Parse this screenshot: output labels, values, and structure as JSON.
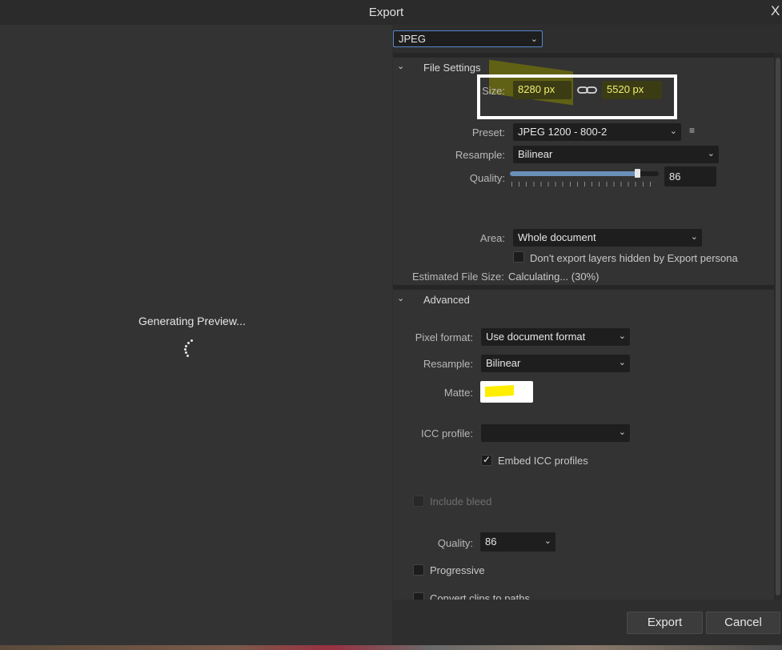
{
  "window": {
    "title": "Export",
    "close_glyph": "X"
  },
  "preview": {
    "generating_text": "Generating Preview..."
  },
  "format": {
    "value": "JPEG"
  },
  "file_settings": {
    "section_title": "File Settings",
    "size_label": "Size:",
    "width": "8280 px",
    "height": "5520 px",
    "preset_label": "Preset:",
    "preset_value": "JPEG 1200 - 800-2",
    "resample_label": "Resample:",
    "resample_value": "Bilinear",
    "quality_label": "Quality:",
    "quality_value": "86",
    "quality_fraction": 0.86,
    "area_label": "Area:",
    "area_value": "Whole document",
    "dont_export_hidden_label": "Don't export layers hidden by Export persona",
    "estimated_size_label": "Estimated File Size:",
    "estimated_size_value": "Calculating... (30%)"
  },
  "advanced": {
    "section_title": "Advanced",
    "pixel_format_label": "Pixel format:",
    "pixel_format_value": "Use document format",
    "resample_label": "Resample:",
    "resample_value": "Bilinear",
    "matte_label": "Matte:",
    "icc_label": "ICC profile:",
    "icc_value": "",
    "embed_icc_label": "Embed ICC profiles",
    "include_bleed_label": "Include bleed",
    "quality_label": "Quality:",
    "quality_value": "86",
    "progressive_label": "Progressive",
    "convert_clips_label": "Convert clips to paths"
  },
  "buttons": {
    "export": "Export",
    "cancel": "Cancel"
  },
  "colors": {
    "highlight": "#ffee00",
    "accent": "#5588cc",
    "annotation": "#ffffff"
  }
}
